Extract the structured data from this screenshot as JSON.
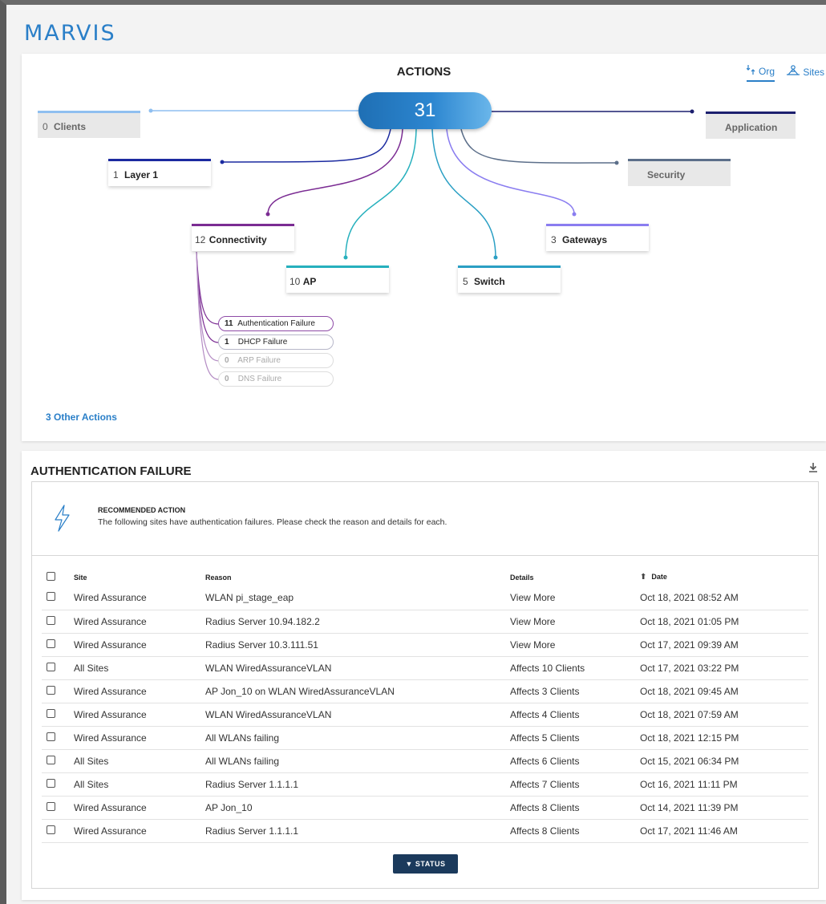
{
  "app": {
    "title": "MARVIS"
  },
  "actions": {
    "title": "ACTIONS",
    "total": "31",
    "view_toggle": {
      "org_label": "Org",
      "sites_label": "Sites"
    },
    "nodes": {
      "clients": {
        "count": "0",
        "label": "Clients"
      },
      "application": {
        "count": "",
        "label": "Application"
      },
      "layer1": {
        "count": "1",
        "label": "Layer 1"
      },
      "security": {
        "count": "",
        "label": "Security"
      },
      "connectivity": {
        "count": "12",
        "label": "Connectivity"
      },
      "gateways": {
        "count": "3",
        "label": "Gateways"
      },
      "ap": {
        "count": "10",
        "label": "AP"
      },
      "switch": {
        "count": "5",
        "label": "Switch"
      }
    },
    "connectivity_sub": [
      {
        "count": "11",
        "label": "Authentication Failure"
      },
      {
        "count": "1",
        "label": "DHCP Failure"
      },
      {
        "count": "0",
        "label": "ARP Failure"
      },
      {
        "count": "0",
        "label": "DNS Failure"
      }
    ],
    "other_actions": "3 Other Actions",
    "colors": {
      "clients": "#8fbff0",
      "application": "#1c1f6e",
      "layer1": "#1b2aa0",
      "security": "#5c6f8a",
      "connectivity": "#7b2c93",
      "gateways": "#8a7df0",
      "ap": "#26b0bd",
      "switch": "#2a9fc4"
    }
  },
  "auth_failure": {
    "title": "AUTHENTICATION FAILURE",
    "recommended_title": "RECOMMENDED ACTION",
    "recommended_text": "The following sites have authentication failures. Please check the reason and details for each.",
    "columns": {
      "site": "Site",
      "reason": "Reason",
      "details": "Details",
      "date": "Date"
    },
    "rows": [
      {
        "site": "Wired Assurance",
        "reason": "WLAN pi_stage_eap",
        "details": "View More",
        "details_link": true,
        "date": "Oct 18, 2021 08:52 AM"
      },
      {
        "site": "Wired Assurance",
        "reason": "Radius Server 10.94.182.2",
        "details": "View More",
        "details_link": true,
        "date": "Oct 18, 2021 01:05 PM"
      },
      {
        "site": "Wired Assurance",
        "reason": "Radius Server 10.3.111.51",
        "details": "View More",
        "details_link": true,
        "date": "Oct 17, 2021 09:39 AM"
      },
      {
        "site": "All Sites",
        "reason": "WLAN WiredAssuranceVLAN",
        "details": "Affects 10 Clients",
        "details_link": false,
        "date": "Oct 17, 2021 03:22 PM"
      },
      {
        "site": "Wired Assurance",
        "reason": "AP Jon_10 on WLAN WiredAssuranceVLAN",
        "details": "Affects 3 Clients",
        "details_link": false,
        "date": "Oct 18, 2021 09:45 AM"
      },
      {
        "site": "Wired Assurance",
        "reason": "WLAN WiredAssuranceVLAN",
        "details": "Affects 4 Clients",
        "details_link": false,
        "date": "Oct 18, 2021 07:59 AM"
      },
      {
        "site": "Wired Assurance",
        "reason": "All WLANs failing",
        "details": "Affects 5 Clients",
        "details_link": false,
        "date": "Oct 18, 2021 12:15 PM"
      },
      {
        "site": "All Sites",
        "reason": "All WLANs failing",
        "details": "Affects 6 Clients",
        "details_link": false,
        "date": "Oct 15, 2021 06:34 PM"
      },
      {
        "site": "All Sites",
        "reason": "Radius Server 1.1.1.1",
        "details": "Affects 7 Clients",
        "details_link": false,
        "date": "Oct 16, 2021 11:11 PM"
      },
      {
        "site": "Wired Assurance",
        "reason": "AP Jon_10",
        "details": "Affects 8 Clients",
        "details_link": false,
        "date": "Oct 14, 2021 11:39 PM"
      },
      {
        "site": "Wired Assurance",
        "reason": "Radius Server 1.1.1.1",
        "details": "Affects 8 Clients",
        "details_link": false,
        "date": "Oct 17, 2021 11:46 AM"
      }
    ],
    "status_button": "▼ STATUS"
  }
}
